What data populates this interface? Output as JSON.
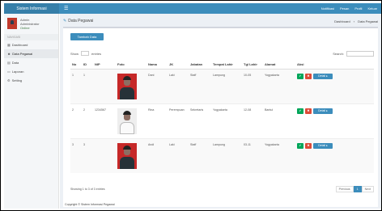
{
  "topbar": {
    "brand": "Sistem Informasi",
    "menu": [
      "Notifikasi",
      "Pesan",
      "Profil",
      "Keluar"
    ]
  },
  "sidebar": {
    "user_name": "Admin",
    "user_role": "Administrator",
    "status": "Online",
    "section": "NAVIGASI",
    "items": [
      {
        "label": "Dashboard",
        "icon": "dashboard-icon"
      },
      {
        "label": "Data Pegawai",
        "icon": "users-icon"
      },
      {
        "label": "Data",
        "icon": "folder-icon"
      },
      {
        "label": "Laporan",
        "icon": "file-icon"
      },
      {
        "label": "Setting",
        "icon": "gear-icon"
      }
    ]
  },
  "header": {
    "title": "Data Pegawai",
    "breadcrumb": [
      "Dashboard",
      "Data Pegawai"
    ]
  },
  "box": {
    "add_label": "Tambah Data",
    "length_label": "Show",
    "length_value": "10",
    "length_suffix": "entries",
    "search_label": "Search:",
    "search_placeholder": ""
  },
  "table": {
    "headers": [
      "No",
      "ID",
      "NIP",
      "Foto",
      "Nama",
      "JK",
      "Jabatan",
      "Tempat Lahir",
      "Tgl Lahir",
      "Alamat",
      "Aksi"
    ],
    "rows": [
      {
        "no": "1",
        "id": "1",
        "nip": "",
        "nama": "Dani",
        "jk": "Laki",
        "jabatan": "Staff",
        "tempat": "Lampung",
        "tgl": "10-05",
        "alamat": "Yogyakarta"
      },
      {
        "no": "2",
        "id": "2",
        "nip": "1234567",
        "nama": "Rina",
        "jk": "Perempuan",
        "jabatan": "Sekretaris",
        "tempat": "Yogyakarta",
        "tgl": "12-08",
        "alamat": "Bantul"
      },
      {
        "no": "3",
        "id": "3",
        "nip": "",
        "nama": "Andi",
        "jk": "Laki",
        "jabatan": "Staff",
        "tempat": "Lampung",
        "tgl": "03-11",
        "alamat": "Yogyakarta"
      }
    ],
    "action_labels": {
      "view": "✔",
      "delete": "✖",
      "detail": "Detail ▸"
    }
  },
  "pagination": {
    "info": "Showing 1 to 3 of 3 entries",
    "prev": "Previous",
    "page": "1",
    "next": "Next"
  },
  "footer": "Copyright © Sistem Informasi Pegawai"
}
